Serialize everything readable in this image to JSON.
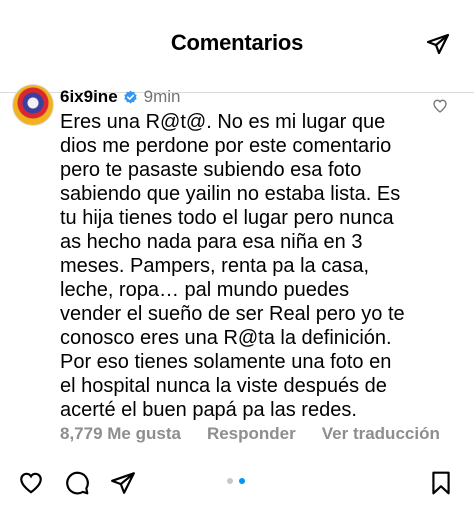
{
  "header": {
    "title": "Comentarios"
  },
  "comment": {
    "username": "6ix9ine",
    "time": "9min",
    "text": "Eres una R@t@. No es mi lugar que\ndios me perdone por este comentario\npero te pasaste subiendo esa foto\nsabiendo que yailin no estaba lista. Es\ntu hija tienes todo el lugar pero nunca\nas hecho nada para esa niña en 3\nmeses. Pampers, renta pa la casa,\nleche, ropa… pal mundo puedes\nvender el sueño de ser Real pero yo te\nconosco eres una R@ta la definición.\nPor eso tienes solamente una foto en\nel hospital nunca la viste después de\nacerté el buen papá pa las redes.",
    "likes": "8,779 Me gusta",
    "reply": "Responder",
    "translate": "Ver traducción"
  },
  "colors": {
    "verified": "#3897f0",
    "active_dot": "#0095f6",
    "inactive_dot": "#c7c7c7"
  },
  "icons": [
    "send-icon",
    "verified-badge-icon",
    "heart-icon",
    "comment-icon",
    "share-icon",
    "bookmark-icon"
  ],
  "carousel": {
    "total": 2,
    "active": 2
  }
}
